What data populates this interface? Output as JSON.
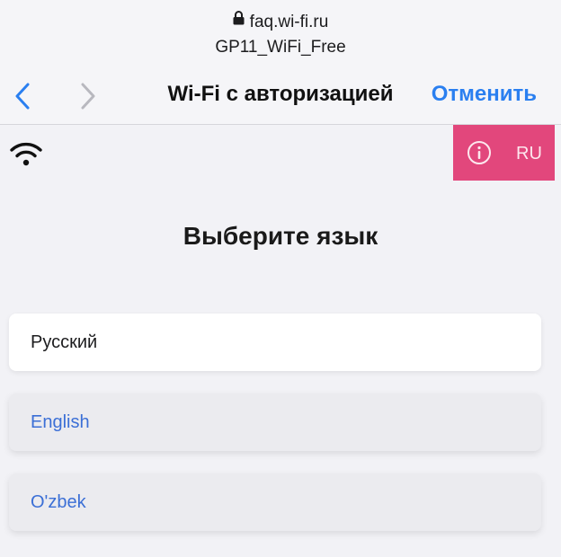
{
  "browser": {
    "url": "faq.wi-fi.ru",
    "network_name": "GP11_WiFi_Free",
    "title": "Wi-Fi с авторизацией",
    "cancel_label": "Отменить"
  },
  "header": {
    "language_badge": "RU"
  },
  "main": {
    "heading": "Выберите язык",
    "languages": [
      {
        "label": "Русский",
        "selected": true
      },
      {
        "label": "English",
        "selected": false
      },
      {
        "label": "O'zbek",
        "selected": false
      }
    ]
  },
  "colors": {
    "accent": "#2a7ff0",
    "badge": "#e2477c",
    "link": "#3b6fd6"
  },
  "icons": [
    "lock-icon",
    "back-chevron-icon",
    "forward-chevron-icon",
    "wifi-icon",
    "info-icon"
  ]
}
